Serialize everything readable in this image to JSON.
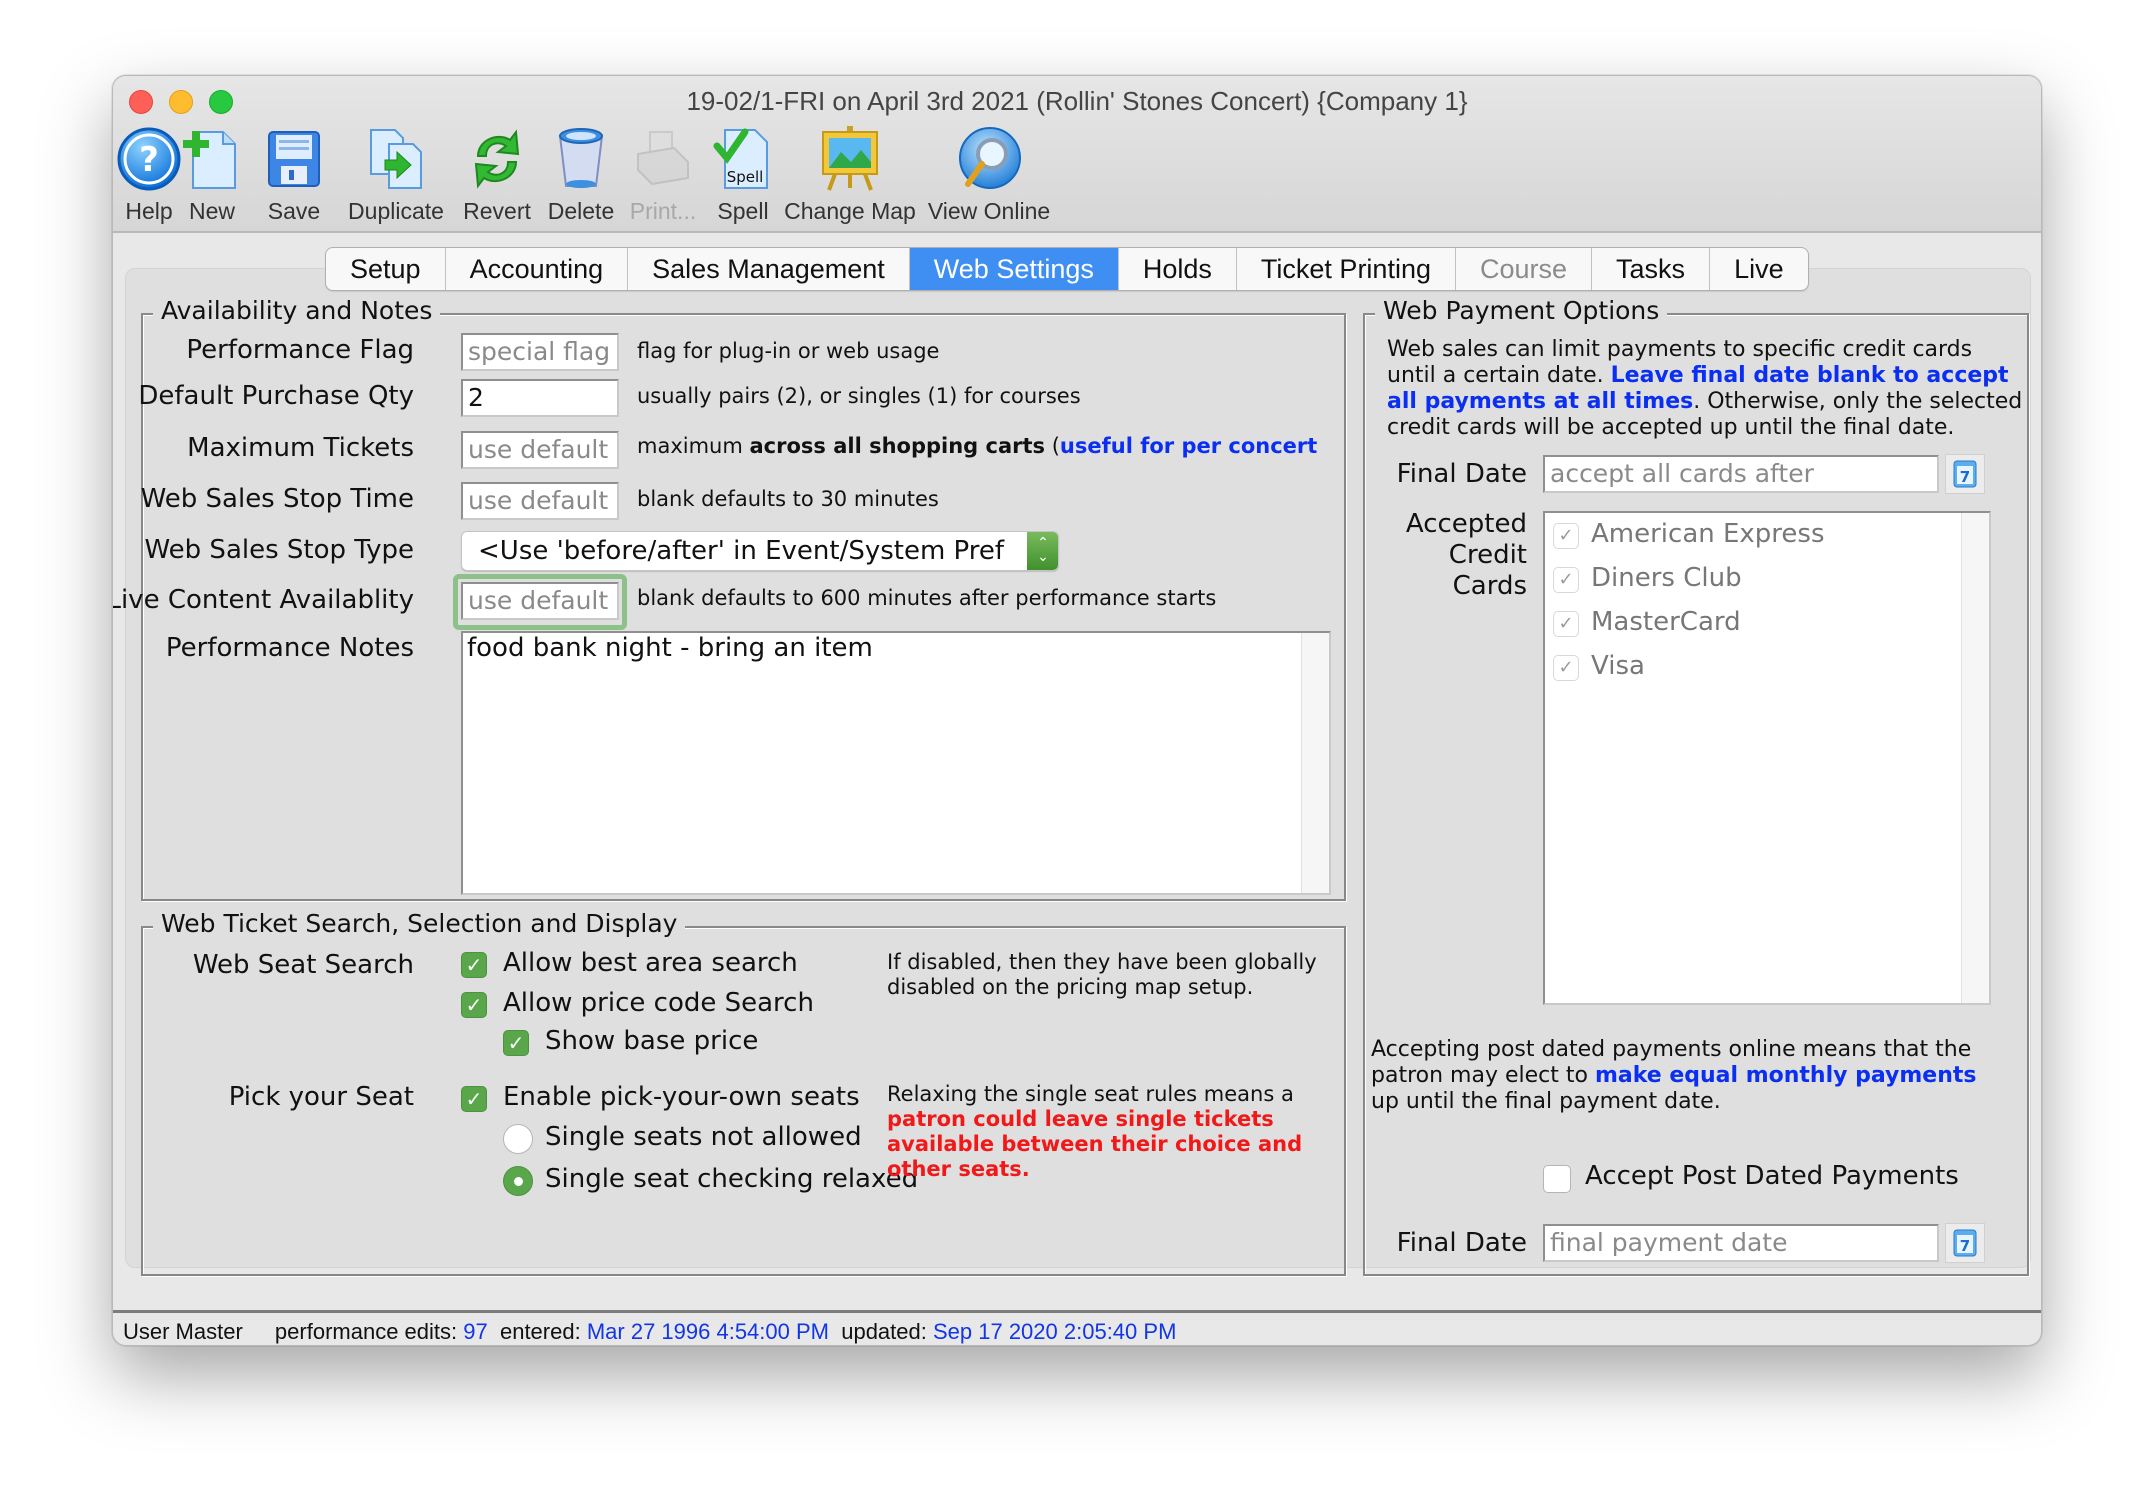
{
  "window": {
    "title": "19-02/1-FRI on April 3rd 2021 (Rollin' Stones Concert) {Company 1}"
  },
  "toolbar": {
    "items": [
      {
        "label": "Help",
        "icon": "help-icon",
        "enabled": true
      },
      {
        "label": "New",
        "icon": "new-document-icon",
        "enabled": true
      },
      {
        "label": "Save",
        "icon": "save-icon",
        "enabled": true
      },
      {
        "label": "Duplicate",
        "icon": "duplicate-icon",
        "enabled": true
      },
      {
        "label": "Revert",
        "icon": "revert-icon",
        "enabled": true
      },
      {
        "label": "Delete",
        "icon": "trash-icon",
        "enabled": true
      },
      {
        "label": "Print...",
        "icon": "printer-icon",
        "enabled": false
      },
      {
        "label": "Spell",
        "icon": "spell-check-icon",
        "enabled": true
      },
      {
        "label": "Change Map",
        "icon": "map-easel-icon",
        "enabled": true
      },
      {
        "label": "View Online",
        "icon": "globe-search-icon",
        "enabled": true
      }
    ],
    "spell_icon_text": "Spell"
  },
  "tabs": [
    {
      "label": "Setup",
      "state": "normal"
    },
    {
      "label": "Accounting",
      "state": "normal"
    },
    {
      "label": "Sales Management",
      "state": "normal"
    },
    {
      "label": "Web Settings",
      "state": "active"
    },
    {
      "label": "Holds",
      "state": "normal"
    },
    {
      "label": "Ticket Printing",
      "state": "normal"
    },
    {
      "label": "Course",
      "state": "disabled"
    },
    {
      "label": "Tasks",
      "state": "normal"
    },
    {
      "label": "Live",
      "state": "normal"
    }
  ],
  "availability": {
    "title": "Availability and Notes",
    "performance_flag": {
      "label": "Performance Flag",
      "value": "",
      "placeholder": "special flag",
      "hint": "flag for plug-in or web usage"
    },
    "default_purchase_qty": {
      "label": "Default Purchase Qty",
      "value": "2",
      "hint": "usually pairs (2), or singles (1) for courses"
    },
    "maximum_tickets": {
      "label": "Maximum Tickets",
      "value": "",
      "placeholder": "use default",
      "hint_prefix": "maximum ",
      "hint_bold": "across all shopping carts",
      "hint_paren": " (",
      "hint_blue": "useful for per concert"
    },
    "web_sales_stop_time": {
      "label": "Web Sales Stop Time",
      "value": "",
      "placeholder": "use default",
      "hint": "blank defaults to 30 minutes"
    },
    "web_sales_stop_type": {
      "label": "Web Sales Stop Type",
      "selected": "<Use 'before/after' in Event/System Pref"
    },
    "live_content_availability": {
      "label": "Live Content Availablity",
      "value": "",
      "placeholder": "use default",
      "hint": "blank defaults to 600 minutes after performance starts"
    },
    "performance_notes": {
      "label": "Performance Notes",
      "value": "food bank night - bring an item"
    }
  },
  "web_ticket": {
    "title": "Web Ticket Search, Selection and Display",
    "web_seat_search_label": "Web Seat Search",
    "allow_best_area": {
      "label": "Allow best area search",
      "checked": true
    },
    "allow_price_code": {
      "label": "Allow price code Search",
      "checked": true
    },
    "show_base_price": {
      "label": "Show base price",
      "checked": true
    },
    "search_note": "If disabled, then they have been globally disabled on the pricing map setup.",
    "pick_your_seat_label": "Pick your Seat",
    "enable_pick_own": {
      "label": "Enable pick-your-own seats",
      "checked": true
    },
    "single_not_allowed": {
      "label": "Single seats not allowed",
      "selected": false
    },
    "single_relaxed": {
      "label": "Single seat checking relaxed",
      "selected": true
    },
    "relax_note_plain": "Relaxing the single seat rules means a ",
    "relax_note_red": "patron could leave single tickets available between their choice and other seats."
  },
  "web_payment": {
    "title": "Web Payment Options",
    "intro_plain": "Web sales can limit payments to specific credit cards until a certain date.  ",
    "intro_blue": "Leave final date blank to accept all payments at all times",
    "intro_rest": ".  Otherwise, only the selected credit cards will be accepted up until the final date.",
    "final_date": {
      "label": "Final Date",
      "value": "",
      "placeholder": "accept all cards after"
    },
    "accepted_cards_label": "Accepted Credit Cards",
    "cards": [
      {
        "name": "American Express",
        "checked": true
      },
      {
        "name": "Diners Club",
        "checked": true
      },
      {
        "name": "MasterCard",
        "checked": true
      },
      {
        "name": "Visa",
        "checked": true
      }
    ],
    "postdated_plain": "Accepting post dated payments online means that the patron may elect to ",
    "postdated_blue": "make equal monthly payments",
    "postdated_rest": " up until the final payment date.",
    "accept_post_dated": {
      "label": "Accept Post Dated Payments",
      "checked": false
    },
    "final_payment_date": {
      "label": "Final Date",
      "value": "",
      "placeholder": "final payment date"
    },
    "calendar_icon_text": "7"
  },
  "status": {
    "user": "User Master",
    "edits_label": "performance edits:",
    "edits_value": "97",
    "entered_label": "entered:",
    "entered_value": "Mar 27 1996 4:54:00 PM",
    "updated_label": "updated:",
    "updated_value": "Sep 17 2020 2:05:40 PM"
  },
  "colors": {
    "active_tab": "#3f8ff2",
    "checkbox_green": "#5aa64a",
    "link_blue": "#0a2ff0",
    "warning_red": "#f01818",
    "focus_ring": "#8dc18a"
  }
}
